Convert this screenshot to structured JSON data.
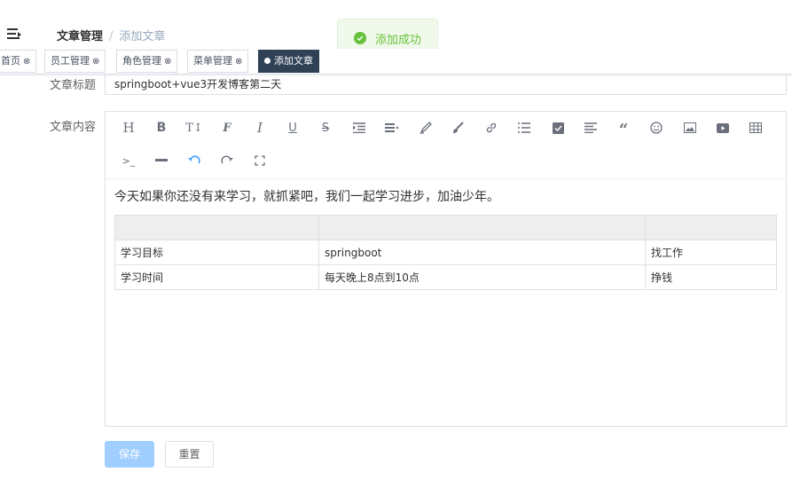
{
  "breadcrumb": {
    "main": "文章管理",
    "separator": "/",
    "current": "添加文章"
  },
  "toast": {
    "message": "添加成功"
  },
  "tags": [
    {
      "label": "首页",
      "close": "⊗"
    },
    {
      "label": "员工管理",
      "close": "⊗"
    },
    {
      "label": "角色管理",
      "close": "⊗"
    },
    {
      "label": "菜单管理",
      "close": "⊗"
    },
    {
      "label": "添加文章"
    }
  ],
  "form": {
    "title_label": "文章标题",
    "title_value": "springboot+vue3开发博客第二天",
    "content_label": "文章内容"
  },
  "editor": {
    "toolbar_icons": [
      "heading-icon",
      "bold-icon",
      "text-size-icon",
      "font-icon",
      "italic-icon",
      "underline-icon",
      "strikethrough-icon",
      "indent-icon",
      "align-icon",
      "highlight-icon",
      "brush-icon",
      "link-icon",
      "unordered-list-icon",
      "checkbox-icon",
      "justify-icon",
      "quote-icon",
      "emoji-icon",
      "image-icon",
      "video-icon",
      "table-icon",
      "code-icon",
      "divider-icon",
      "undo-icon",
      "redo-icon",
      "fullscreen-icon"
    ],
    "text": "今天如果你还没有来学习，就抓紧吧，我们一起学习进步，加油少年。",
    "table": {
      "headers": [
        "",
        "",
        ""
      ],
      "rows": [
        [
          "学习目标",
          "springboot",
          "找工作"
        ],
        [
          "学习时间",
          "每天晚上8点到10点",
          "挣钱"
        ]
      ]
    }
  },
  "buttons": {
    "save": "保存",
    "reset": "重置"
  },
  "colors": {
    "success": "#67c23a",
    "active_tag": "#304156",
    "primary_disabled": "#a0cfff"
  }
}
